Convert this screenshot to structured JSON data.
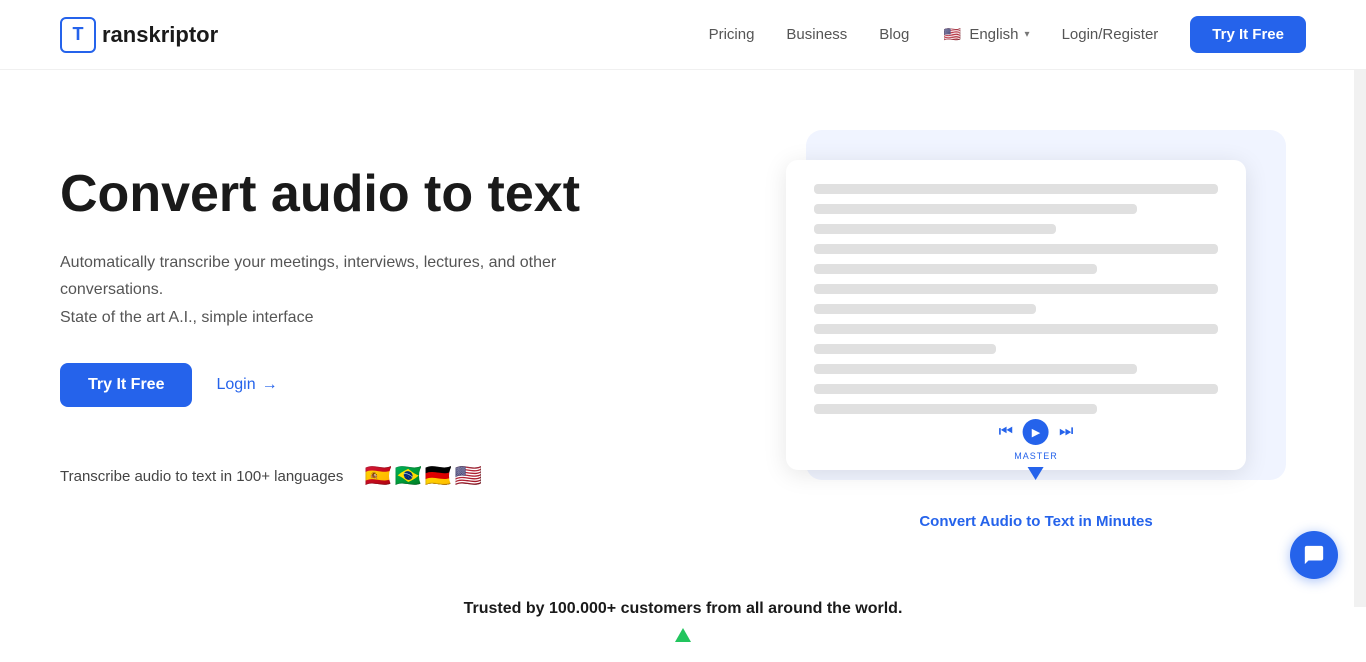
{
  "header": {
    "logo_letter": "T",
    "logo_name_prefix": "",
    "logo_name": "ranskriptor",
    "nav": {
      "pricing": "Pricing",
      "business": "Business",
      "blog": "Blog",
      "language": "English",
      "language_flag": "🇺🇸",
      "login_register": "Login/Register",
      "try_free": "Try It Free"
    }
  },
  "hero": {
    "title": "Convert audio to text",
    "desc1": "Automatically transcribe your meetings, interviews, lectures, and other conversations.",
    "desc2": "State of the art A.I., simple interface",
    "cta_primary": "Try It Free",
    "cta_secondary": "Login",
    "languages_label": "Transcribe audio to text in 100+ languages",
    "flags": [
      "🇪🇸",
      "🇧🇷",
      "🇩🇪",
      "🇺🇸"
    ],
    "mockup_convert_label": "Convert Audio to Text in Minutes"
  },
  "trusted": {
    "text": "Trusted by 100.000+ customers from all around the world."
  },
  "chat": {
    "icon_label": "chat-icon"
  }
}
